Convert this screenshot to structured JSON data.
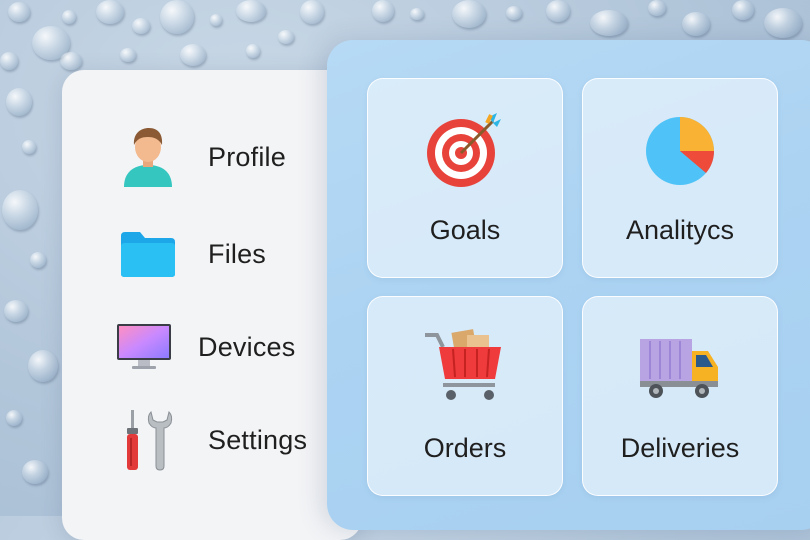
{
  "menu": {
    "items": [
      {
        "id": "profile",
        "label": "Profile",
        "icon": "user-icon"
      },
      {
        "id": "files",
        "label": "Files",
        "icon": "folder-icon"
      },
      {
        "id": "devices",
        "label": "Devices",
        "icon": "monitor-icon"
      },
      {
        "id": "settings",
        "label": "Settings",
        "icon": "tools-icon"
      }
    ]
  },
  "tiles": [
    {
      "id": "goals",
      "label": "Goals",
      "icon": "target-icon"
    },
    {
      "id": "analytics",
      "label": "Analitycs",
      "icon": "pie-chart-icon"
    },
    {
      "id": "orders",
      "label": "Orders",
      "icon": "shopping-cart-icon"
    },
    {
      "id": "deliveries",
      "label": "Deliveries",
      "icon": "truck-icon"
    }
  ],
  "colors": {
    "panel_left": "#f3f4f6",
    "panel_right": "#acd3f2",
    "tile": "#e8f2fb",
    "text": "#1f1f1f"
  }
}
